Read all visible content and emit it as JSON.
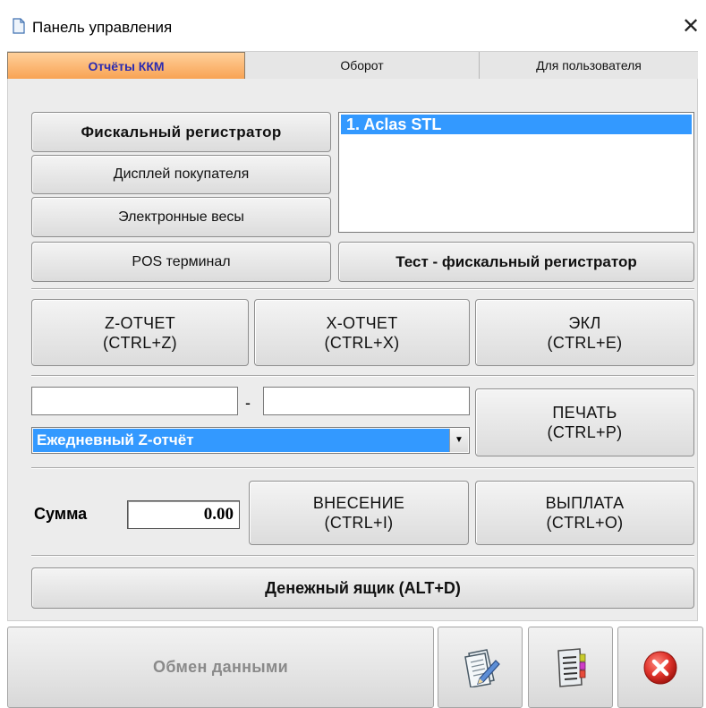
{
  "window": {
    "title": "Панель управления",
    "close_glyph": "✕"
  },
  "tabs": [
    {
      "label": "Отчёты ККМ",
      "active": true
    },
    {
      "label": "Оборот",
      "active": false
    },
    {
      "label": "Для пользователя",
      "active": false
    }
  ],
  "devices": {
    "fiscal": "Фискальный регистратор",
    "display": "Дисплей покупателя",
    "scales": "Электронные весы",
    "pos": "POS терминал"
  },
  "device_list": {
    "items": [
      "1.  Aclas STL"
    ],
    "selected_index": 0
  },
  "test_button": "Тест - фискальный регистратор",
  "reports": {
    "z": {
      "line1": "Z-ОТЧЕТ",
      "line2": "(CTRL+Z)"
    },
    "x": {
      "line1": "X-ОТЧЕТ",
      "line2": "(CTRL+X)"
    },
    "ekl": {
      "line1": "ЭКЛ",
      "line2": "(CTRL+E)"
    }
  },
  "period": {
    "from_value": "",
    "separator": "-",
    "to_value": "",
    "report_type": "Ежедневный Z-отчёт"
  },
  "print_button": {
    "line1": "ПЕЧАТЬ",
    "line2": "(CTRL+P)"
  },
  "cash": {
    "sum_label": "Сумма",
    "sum_value": "0.00",
    "deposit": {
      "line1": "ВНЕСЕНИЕ",
      "line2": "(CTRL+I)"
    },
    "withdraw": {
      "line1": "ВЫПЛАТА",
      "line2": "(CTRL+O)"
    }
  },
  "drawer_button": "Денежный ящик (ALT+D)",
  "bottom": {
    "exchange_label": "Обмен данными",
    "icons": [
      "report-edit-icon",
      "document-list-icon",
      "exit-icon"
    ]
  },
  "colors": {
    "active_tab": "#f8a354",
    "selection": "#3399ff",
    "exit_red": "#e0342c"
  }
}
